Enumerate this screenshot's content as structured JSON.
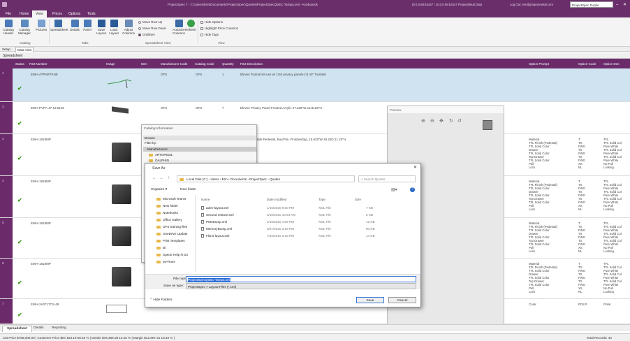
{
  "titlebar": {
    "title": "ProjectSpec 7 - C:\\Users\\Erin\\Documents\\ProjectSpec\\Quotes\\ProjectSpecQ5BC-Tampa.xml - Keyboards",
    "conn": "(0.0.0.88:53447 \\ 10.0.0.88:53447 ProjectMetal Data",
    "logout": "Log Out: erin@projectmetal.com",
    "user_select": "ProjectSpec Purple"
  },
  "menu": [
    "File",
    "Home",
    "View",
    "Prices",
    "Options",
    "Tools"
  ],
  "ribbon": {
    "buttons": [
      "Catalog Header",
      "Catalog Manager",
      "Pictures",
      "Spreadsheet",
      "Details",
      "Panel",
      "Save Layout",
      "Load Layout",
      "Adjust Columns",
      "Autosize Columns",
      "Refresh"
    ],
    "radios": [
      "Move Row Up",
      "Move Row Down",
      "Gridlines"
    ],
    "checks": [
      "Hide Options",
      "Highlight Price Columns",
      "Hide Tags"
    ],
    "groups": [
      "Catalog",
      "Tabs",
      "Spreadsheet View",
      "View"
    ]
  },
  "setupbar": {
    "setup": "Setup",
    "dataview": "Data View"
  },
  "grid": {
    "title": "Spreadsheet",
    "headers": [
      "Status",
      "Part Number",
      "Image",
      "Item",
      "Manufacturer Code",
      "Catalog Code",
      "Quantity",
      "Part Description",
      "Option Prompt",
      "Option Code",
      "Option Des"
    ],
    "rows": [
      {
        "num": "1",
        "part": "EWH-ATPNRTKNE",
        "mfr": "OFS",
        "cat": "OFS",
        "qty": "1",
        "desc": "Eleven Toolrail Kit-use w/ 1/40 privacy panels-(?) 40\" Toolrails"
      },
      {
        "num": "2",
        "part": "EWH-PVPA-47-12.5125",
        "mfr": "OFS",
        "cat": "OFS",
        "qty": "7",
        "desc": "Eleven Privacy Panel-Frosted Acrylic 47.625\"W 12.8125\"H"
      },
      {
        "num": "3",
        "part": "EWH-1818MP",
        "desc": "obile Pedestal, Box/File, Finishes/tag, 15.625\"W 18.25D 21.25\"H"
      },
      {
        "num": "4",
        "part": "EWH-1818MP"
      },
      {
        "num": "5",
        "part": "EWH-1818MP"
      },
      {
        "num": "6",
        "part": "EWH-1818MP"
      },
      {
        "num": "7",
        "part": "EWH-2A0717CS-48",
        "opt": "Color",
        "code": "POLR",
        "des": "Polar"
      }
    ],
    "opt_lines": "Material\nTFL Finish (Pedestal)\nTFL Solid Color\nDrawer\nTFL Solid Color\nTop Drawer\nTFL Solid Color\nPull\nLock",
    "code_lines": "T\nTS\nFWG\nTS\nFWG\nTS\nFWG\nXS\nNL",
    "des_lines": "TFL\nTFL Solid Col\nPure White\nTFL Solid Col\nPure White\nTFL Solid Col\nPure White\nNo Pull\nLocking"
  },
  "preview": {
    "title": "Preview"
  },
  "catinfo": {
    "title": "Catalog Information",
    "tabs": [
      "Browse",
      "Filter by:"
    ],
    "group": "Manufacturers",
    "items": [
      "ARTOPEDIL",
      "OALPHIN"
    ]
  },
  "saveas": {
    "title": "Save As",
    "crumbs": [
      "Local Disk (C:)",
      "Users",
      "Erin",
      "Documents",
      "ProjectSpec",
      "Quotes"
    ],
    "search": "Search Quotes",
    "organize": "Organize",
    "newfolder": "New folder",
    "folders": [
      "Microsoft Teams",
      "New folder",
      "Notebooks",
      "Office Gallery",
      "OFS training files",
      "OneDrive Update",
      "Print Templates",
      "sit",
      "SpecE Help N Do",
      "sw-Rose"
    ],
    "cols": [
      "Name",
      "Date modified",
      "Type",
      "Size"
    ],
    "files": [
      {
        "n": "aden-layout.xml",
        "d": "1/15/2020 9:30 PM",
        "t": "XML File",
        "s": "7 KB"
      },
      {
        "n": "Second restore.xml",
        "d": "2/10/2020 10:54 AM",
        "t": "XML File",
        "s": "6 KB"
      },
      {
        "n": "PM4Dump.xml",
        "d": "2/10/2020 4:56 PM",
        "t": "XML File",
        "s": "12 KB"
      },
      {
        "n": "MemoryDump.xml",
        "d": "3/27/2020 3:16 PM",
        "t": "XML File",
        "s": "90 KB"
      },
      {
        "n": "Flat 6 layout.xml",
        "d": "7/22/2019 3:16 PM",
        "t": "XML File",
        "s": "14 KB"
      }
    ],
    "filename_label": "File name:",
    "filename": "ProjectSpecQ5BC-Tampa.xml",
    "type_label": "Save as type:",
    "type": "ProjectSpec 7 Layout Files (*.xml)",
    "hide": "Hide Folders",
    "save": "Save",
    "cancel": "Cancel"
  },
  "bottomtabs": [
    "Spreadsheet",
    "Details",
    "Reporting"
  ],
  "status": {
    "left": "List Price $765,000.00 | Customer Price $87,153.19  50.33 % | Dealer $78,465.08  10.25 % | Margin $12,907.31  18.20 % |",
    "right": "Total Records: 43"
  },
  "colors": {
    "accent": "#6b2b6b"
  }
}
